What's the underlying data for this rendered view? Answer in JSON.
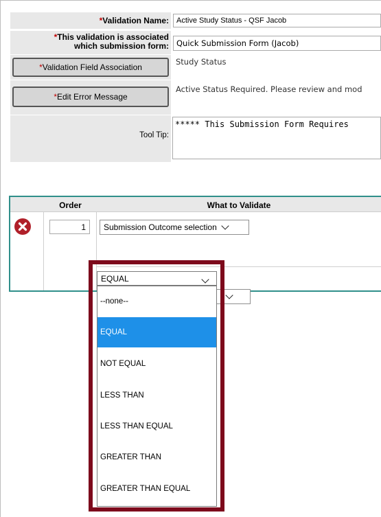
{
  "form": {
    "validation_name_label": "Validation Name:",
    "validation_name_value": "Active Study Status - QSF Jacob",
    "assoc_label_line1": "This validation is associated",
    "assoc_label_line2": "which submission form:",
    "assoc_value": "Quick Submission Form (Jacob)",
    "field_assoc_button": "Validation Field Association",
    "field_assoc_value": "Study Status",
    "edit_error_button": "Edit Error Message",
    "error_message_value": "Active Status Required. Please review and mod",
    "tooltip_label": "Tool Tip:",
    "tooltip_value": "***** This Submission Form Requires",
    "required_mark": "*"
  },
  "grid": {
    "col_order": "Order",
    "col_what": "What to Validate",
    "row_order_value": "1",
    "row_what_value": "Submission Outcome selection"
  },
  "dropdown": {
    "selected": "EQUAL",
    "options": [
      "--none--",
      "EQUAL",
      "NOT EQUAL",
      "LESS THAN",
      "LESS THAN EQUAL",
      "GREATER THAN",
      "GREATER THAN EQUAL"
    ],
    "highlighted": "EQUAL"
  },
  "colors": {
    "highlight_border": "#7d0a1c",
    "grid_border": "#2f8f8a",
    "delete_icon": "#b0202a",
    "selected_option_bg": "#1e90e8"
  }
}
